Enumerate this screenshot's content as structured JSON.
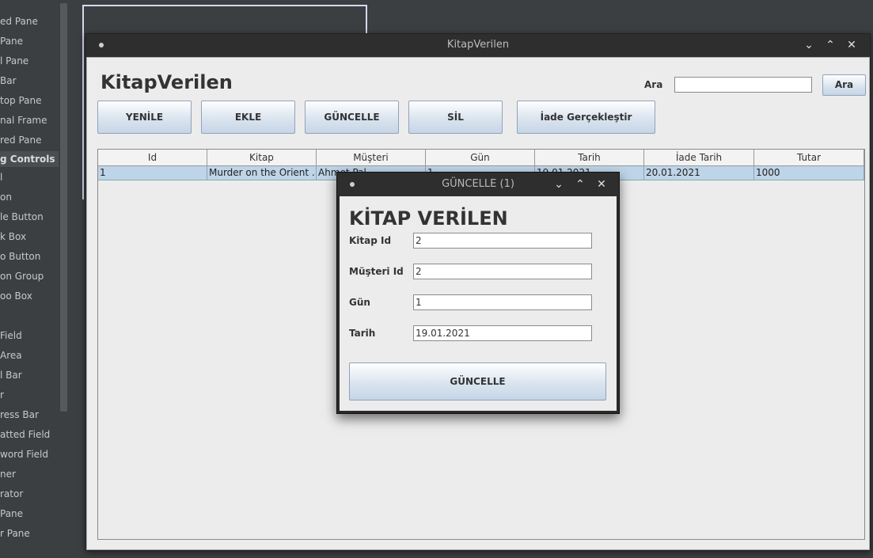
{
  "palette": {
    "items": [
      {
        "label": "ed Pane"
      },
      {
        "label": "Pane"
      },
      {
        "label": "l Pane"
      },
      {
        "label": "Bar"
      },
      {
        "label": "top Pane"
      },
      {
        "label": "nal Frame"
      },
      {
        "label": "red Pane"
      },
      {
        "label": "g Controls",
        "category": true
      },
      {
        "label": "l"
      },
      {
        "label": "on"
      },
      {
        "label": "le Button"
      },
      {
        "label": "k Box"
      },
      {
        "label": "o Button"
      },
      {
        "label": "on Group"
      },
      {
        "label": "oo Box"
      },
      {
        "label": ""
      },
      {
        "label": "Field"
      },
      {
        "label": "Area"
      },
      {
        "label": "l Bar"
      },
      {
        "label": "r"
      },
      {
        "label": "ress Bar"
      },
      {
        "label": "atted Field"
      },
      {
        "label": "word Field"
      },
      {
        "label": "ner"
      },
      {
        "label": "rator"
      },
      {
        "label": "Pane"
      },
      {
        "label": "r Pane"
      }
    ]
  },
  "window": {
    "title": "KitapVerilen",
    "heading": "KitapVerilen",
    "search_label": "Ara",
    "search_value": "",
    "search_button": "Ara",
    "toolbar": {
      "refresh": "YENİLE",
      "add": "EKLE",
      "update": "GÜNCELLE",
      "delete": "SİL",
      "return": "İade Gerçekleştir"
    },
    "table": {
      "columns": [
        "Id",
        "Kitap",
        "Müşteri",
        "Gün",
        "Tarih",
        "İade Tarih",
        "Tutar"
      ],
      "rows": [
        [
          "1",
          "Murder on the Orient ...",
          "Ahmet Pal",
          "1",
          "19.01.2021",
          "20.01.2021",
          "1000"
        ]
      ]
    }
  },
  "dialog": {
    "title": "GÜNCELLE (1)",
    "heading": "KİTAP VERİLEN",
    "fields": {
      "kitap_id": {
        "label": "Kitap Id",
        "value": "2"
      },
      "musteri_id": {
        "label": "Müşteri Id",
        "value": "2"
      },
      "gun": {
        "label": "Gün",
        "value": "1"
      },
      "tarih": {
        "label": "Tarih",
        "value": "19.01.2021"
      }
    },
    "submit": "GÜNCELLE"
  }
}
